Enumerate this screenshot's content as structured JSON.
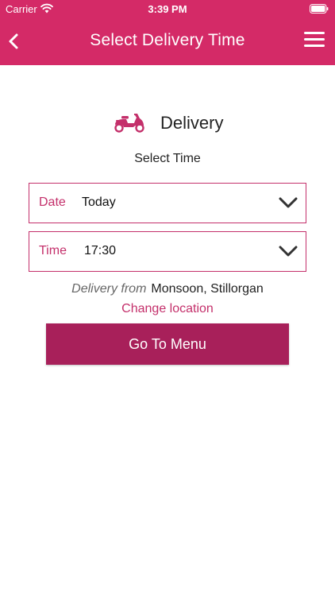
{
  "status_bar": {
    "carrier": "Carrier",
    "time": "3:39 PM",
    "background": "#d42a67"
  },
  "header": {
    "title": "Select Delivery Time",
    "back_icon": "chevron-left-icon",
    "menu_icon": "hamburger-menu-icon",
    "background": "#d42a67"
  },
  "mode": {
    "icon": "scooter-icon",
    "label": "Delivery"
  },
  "select_time_label": "Select Time",
  "date_select": {
    "label": "Date",
    "value": "Today"
  },
  "time_select": {
    "label": "Time",
    "value": "17:30"
  },
  "delivery_from": {
    "prefix": "Delivery from",
    "location": "Monsoon, Stillorgan"
  },
  "change_location": "Change location",
  "go_to_menu": "Go To Menu",
  "colors": {
    "accent": "#c4306b",
    "button": "#a8205a"
  }
}
